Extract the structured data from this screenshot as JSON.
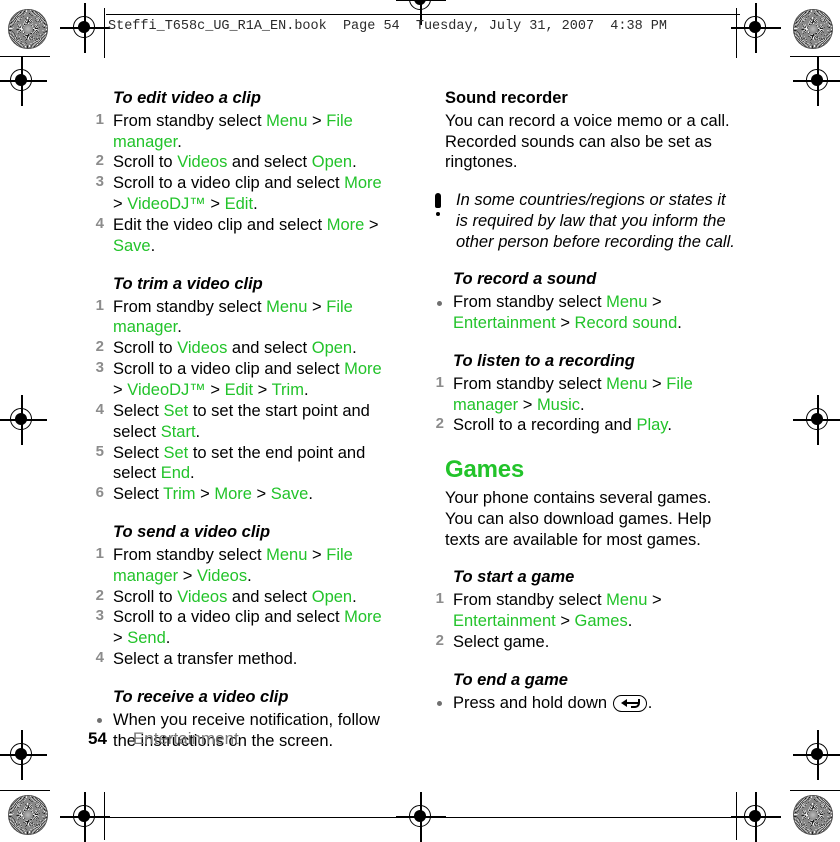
{
  "header": {
    "line": "Steffi_T658c_UG_R1A_EN.book  Page 54  Tuesday, July 31, 2007  4:38 PM"
  },
  "footer": {
    "page_number": "54",
    "section": "Entertainment"
  },
  "colors": {
    "ui_green": "#22c32a",
    "step_number_gray": "#8c8c8c",
    "footer_gray": "#777777"
  },
  "left_column": {
    "sections": [
      {
        "heading": "To edit video a clip",
        "list_type": "ordered",
        "steps": [
          {
            "num": "1",
            "parts": [
              {
                "t": "From standby select ",
                "c": "plain"
              },
              {
                "t": "Menu",
                "c": "ui"
              },
              {
                "t": " > ",
                "c": "plain"
              },
              {
                "t": "File manager",
                "c": "ui"
              },
              {
                "t": ".",
                "c": "plain"
              }
            ]
          },
          {
            "num": "2",
            "parts": [
              {
                "t": "Scroll to ",
                "c": "plain"
              },
              {
                "t": "Videos",
                "c": "ui"
              },
              {
                "t": " and select ",
                "c": "plain"
              },
              {
                "t": "Open",
                "c": "ui"
              },
              {
                "t": ".",
                "c": "plain"
              }
            ]
          },
          {
            "num": "3",
            "parts": [
              {
                "t": "Scroll to a video clip and select ",
                "c": "plain"
              },
              {
                "t": "More",
                "c": "ui"
              },
              {
                "t": " > ",
                "c": "plain"
              },
              {
                "t": "VideoDJ™",
                "c": "ui"
              },
              {
                "t": " > ",
                "c": "plain"
              },
              {
                "t": "Edit",
                "c": "ui"
              },
              {
                "t": ".",
                "c": "plain"
              }
            ]
          },
          {
            "num": "4",
            "parts": [
              {
                "t": "Edit the video clip and select ",
                "c": "plain"
              },
              {
                "t": "More",
                "c": "ui"
              },
              {
                "t": " > ",
                "c": "plain"
              },
              {
                "t": "Save",
                "c": "ui"
              },
              {
                "t": ".",
                "c": "plain"
              }
            ]
          }
        ]
      },
      {
        "heading": "To trim a video clip",
        "list_type": "ordered",
        "steps": [
          {
            "num": "1",
            "parts": [
              {
                "t": "From standby select ",
                "c": "plain"
              },
              {
                "t": "Menu",
                "c": "ui"
              },
              {
                "t": " > ",
                "c": "plain"
              },
              {
                "t": "File manager",
                "c": "ui"
              },
              {
                "t": ".",
                "c": "plain"
              }
            ]
          },
          {
            "num": "2",
            "parts": [
              {
                "t": "Scroll to ",
                "c": "plain"
              },
              {
                "t": "Videos",
                "c": "ui"
              },
              {
                "t": " and select ",
                "c": "plain"
              },
              {
                "t": "Open",
                "c": "ui"
              },
              {
                "t": ".",
                "c": "plain"
              }
            ]
          },
          {
            "num": "3",
            "parts": [
              {
                "t": "Scroll to a video clip and select ",
                "c": "plain"
              },
              {
                "t": "More",
                "c": "ui"
              },
              {
                "t": " > ",
                "c": "plain"
              },
              {
                "t": "VideoDJ™",
                "c": "ui"
              },
              {
                "t": " > ",
                "c": "plain"
              },
              {
                "t": "Edit",
                "c": "ui"
              },
              {
                "t": " > ",
                "c": "plain"
              },
              {
                "t": "Trim",
                "c": "ui"
              },
              {
                "t": ".",
                "c": "plain"
              }
            ]
          },
          {
            "num": "4",
            "parts": [
              {
                "t": "Select ",
                "c": "plain"
              },
              {
                "t": "Set",
                "c": "ui"
              },
              {
                "t": " to set the start point and select ",
                "c": "plain"
              },
              {
                "t": "Start",
                "c": "ui"
              },
              {
                "t": ".",
                "c": "plain"
              }
            ]
          },
          {
            "num": "5",
            "parts": [
              {
                "t": "Select ",
                "c": "plain"
              },
              {
                "t": "Set",
                "c": "ui"
              },
              {
                "t": " to set the end point and select ",
                "c": "plain"
              },
              {
                "t": "End",
                "c": "ui"
              },
              {
                "t": ".",
                "c": "plain"
              }
            ]
          },
          {
            "num": "6",
            "parts": [
              {
                "t": "Select ",
                "c": "plain"
              },
              {
                "t": "Trim",
                "c": "ui"
              },
              {
                "t": " > ",
                "c": "plain"
              },
              {
                "t": "More",
                "c": "ui"
              },
              {
                "t": " > ",
                "c": "plain"
              },
              {
                "t": "Save",
                "c": "ui"
              },
              {
                "t": ".",
                "c": "plain"
              }
            ]
          }
        ]
      },
      {
        "heading": "To send a video clip",
        "list_type": "ordered",
        "steps": [
          {
            "num": "1",
            "parts": [
              {
                "t": "From standby select ",
                "c": "plain"
              },
              {
                "t": "Menu",
                "c": "ui"
              },
              {
                "t": " > ",
                "c": "plain"
              },
              {
                "t": "File manager",
                "c": "ui"
              },
              {
                "t": " > ",
                "c": "plain"
              },
              {
                "t": "Videos",
                "c": "ui"
              },
              {
                "t": ".",
                "c": "plain"
              }
            ]
          },
          {
            "num": "2",
            "parts": [
              {
                "t": "Scroll to ",
                "c": "plain"
              },
              {
                "t": "Videos",
                "c": "ui"
              },
              {
                "t": " and select ",
                "c": "plain"
              },
              {
                "t": "Open",
                "c": "ui"
              },
              {
                "t": ".",
                "c": "plain"
              }
            ]
          },
          {
            "num": "3",
            "parts": [
              {
                "t": "Scroll to a video clip and select ",
                "c": "plain"
              },
              {
                "t": "More",
                "c": "ui"
              },
              {
                "t": " > ",
                "c": "plain"
              },
              {
                "t": "Send",
                "c": "ui"
              },
              {
                "t": ".",
                "c": "plain"
              }
            ]
          },
          {
            "num": "4",
            "parts": [
              {
                "t": "Select a transfer method.",
                "c": "plain"
              }
            ]
          }
        ]
      },
      {
        "heading": "To receive a video clip",
        "list_type": "bulleted",
        "steps": [
          {
            "num": "",
            "parts": [
              {
                "t": "When you receive notification, follow the instructions on the screen.",
                "c": "plain"
              }
            ]
          }
        ]
      }
    ]
  },
  "right_column": {
    "topic_heading": "Sound recorder",
    "topic_body": "You can record a voice memo or a call. Recorded sounds can also be set as ringtones.",
    "warning": {
      "icon": "exclamation-icon",
      "text": "In some countries/regions or states it is required by law that you inform the other person before recording the call."
    },
    "sections": [
      {
        "heading": "To record a sound",
        "list_type": "bulleted",
        "steps": [
          {
            "num": "",
            "parts": [
              {
                "t": "From standby select ",
                "c": "plain"
              },
              {
                "t": "Menu",
                "c": "ui"
              },
              {
                "t": " > ",
                "c": "plain"
              },
              {
                "t": "Entertainment",
                "c": "ui"
              },
              {
                "t": " > ",
                "c": "plain"
              },
              {
                "t": "Record sound",
                "c": "ui"
              },
              {
                "t": ".",
                "c": "plain"
              }
            ]
          }
        ]
      },
      {
        "heading": "To listen to a recording",
        "list_type": "ordered",
        "steps": [
          {
            "num": "1",
            "parts": [
              {
                "t": "From standby select ",
                "c": "plain"
              },
              {
                "t": "Menu",
                "c": "ui"
              },
              {
                "t": " > ",
                "c": "plain"
              },
              {
                "t": "File manager",
                "c": "ui"
              },
              {
                "t": " > ",
                "c": "plain"
              },
              {
                "t": "Music",
                "c": "ui"
              },
              {
                "t": ".",
                "c": "plain"
              }
            ]
          },
          {
            "num": "2",
            "parts": [
              {
                "t": "Scroll to a recording and ",
                "c": "plain"
              },
              {
                "t": "Play",
                "c": "ui"
              },
              {
                "t": ".",
                "c": "plain"
              }
            ]
          }
        ]
      }
    ],
    "games": {
      "chapter_heading": "Games",
      "body": "Your phone contains several games. You can also download games. Help texts are available for most games.",
      "sections": [
        {
          "heading": "To start a game",
          "list_type": "ordered",
          "steps": [
            {
              "num": "1",
              "parts": [
                {
                  "t": "From standby select ",
                  "c": "plain"
                },
                {
                  "t": "Menu",
                  "c": "ui"
                },
                {
                  "t": " > ",
                  "c": "plain"
                },
                {
                  "t": "Entertainment",
                  "c": "ui"
                },
                {
                  "t": " > ",
                  "c": "plain"
                },
                {
                  "t": "Games",
                  "c": "ui"
                },
                {
                  "t": ".",
                  "c": "plain"
                }
              ]
            },
            {
              "num": "2",
              "parts": [
                {
                  "t": "Select game.",
                  "c": "plain"
                }
              ]
            }
          ]
        },
        {
          "heading": "To end a game",
          "list_type": "bulleted",
          "steps": [
            {
              "num": "",
              "parts": [
                {
                  "t": "Press and hold down ",
                  "c": "plain"
                },
                {
                  "t": "",
                  "c": "keycap"
                },
                {
                  "t": ".",
                  "c": "plain"
                }
              ]
            }
          ]
        }
      ]
    }
  }
}
